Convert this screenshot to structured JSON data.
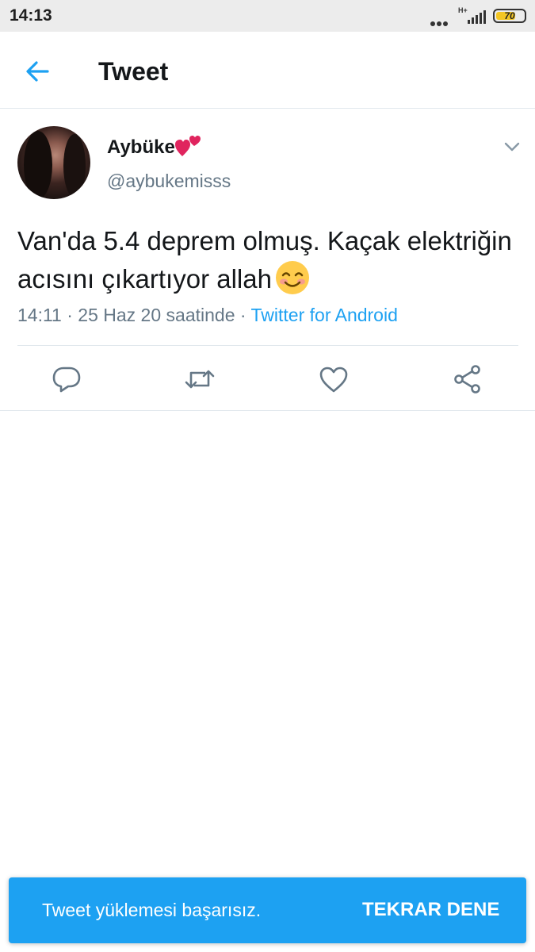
{
  "status_bar": {
    "time": "14:13",
    "network": "H+",
    "battery": "70",
    "battery_level": 0.7,
    "battery_color": "#f3c623"
  },
  "app_bar": {
    "back_icon": "arrow-left-icon",
    "title": "Tweet"
  },
  "tweet": {
    "display_name": "Aybüke",
    "name_emoji": "two-hearts-emoji",
    "handle": "@aybukemisss",
    "text": "Van'da 5.4 deprem olmuş. Kaçak elektriğin acısını çıkartıyor allah",
    "text_emoji": "smiling-face-with-smiling-eyes-emoji",
    "meta_time": "14:11 · 25 Haz 20 saatinde · ",
    "source": "Twitter for Android",
    "actions": [
      "reply-icon",
      "retweet-icon",
      "like-icon",
      "share-icon"
    ]
  },
  "snackbar": {
    "message": "Tweet yüklemesi başarısız.",
    "action": "TEKRAR DENE"
  },
  "colors": {
    "accent": "#1da1f2",
    "text": "#14171a",
    "secondary": "#657786",
    "divider": "#e1e8ed"
  }
}
